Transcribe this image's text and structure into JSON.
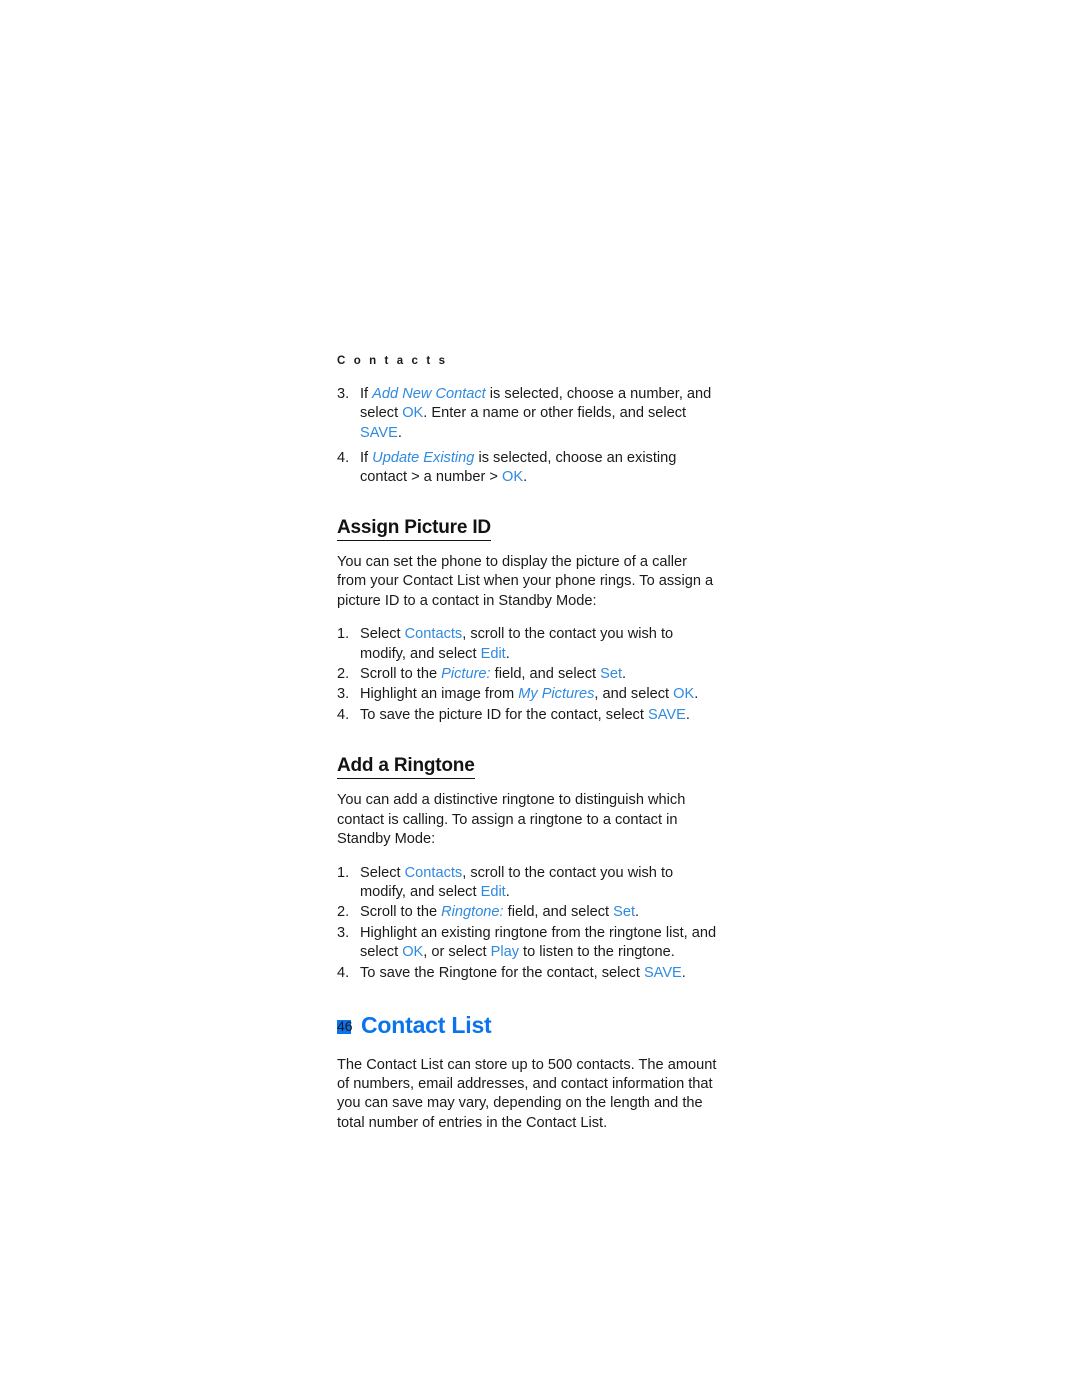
{
  "document": {
    "running_header": "C o n t a c t s",
    "page_number": "46",
    "accent_color": "#2f8ae0",
    "section_heading_color": "#0a74ec",
    "text_color": "#1a1a1a",
    "background_color": "#ffffff"
  },
  "top_steps": {
    "items": [
      {
        "num": "3.",
        "parts": [
          {
            "t": "If ",
            "style": "plain"
          },
          {
            "t": "Add New Contact",
            "style": "ui-italic"
          },
          {
            "t": " is selected, choose a number, and select ",
            "style": "plain"
          },
          {
            "t": "OK",
            "style": "ui"
          },
          {
            "t": ". Enter a name or other fields, and select ",
            "style": "plain"
          },
          {
            "t": "SAVE",
            "style": "ui"
          },
          {
            "t": ".",
            "style": "plain"
          }
        ]
      },
      {
        "num": "4.",
        "parts": [
          {
            "t": "If ",
            "style": "plain"
          },
          {
            "t": "Update Existing",
            "style": "ui-italic"
          },
          {
            "t": " is selected, choose an existing contact > a number > ",
            "style": "plain"
          },
          {
            "t": "OK",
            "style": "ui"
          },
          {
            "t": ".",
            "style": "plain"
          }
        ]
      }
    ]
  },
  "assign_picture_id": {
    "heading": "Assign Picture ID",
    "intro": "You can set the phone to display the picture of a caller from your Contact List when your phone rings. To assign a picture ID to a contact in Standby Mode:",
    "steps": [
      {
        "num": "1.",
        "parts": [
          {
            "t": "Select ",
            "style": "plain"
          },
          {
            "t": "Contacts",
            "style": "ui"
          },
          {
            "t": ", scroll to the contact you wish to modify, and select ",
            "style": "plain"
          },
          {
            "t": "Edit",
            "style": "ui"
          },
          {
            "t": ".",
            "style": "plain"
          }
        ]
      },
      {
        "num": "2.",
        "parts": [
          {
            "t": "Scroll to the ",
            "style": "plain"
          },
          {
            "t": "Picture:",
            "style": "ui-italic"
          },
          {
            "t": " field, and select ",
            "style": "plain"
          },
          {
            "t": "Set",
            "style": "ui"
          },
          {
            "t": ".",
            "style": "plain"
          }
        ]
      },
      {
        "num": "3.",
        "parts": [
          {
            "t": "Highlight an image from ",
            "style": "plain"
          },
          {
            "t": "My Pictures",
            "style": "ui-italic"
          },
          {
            "t": ", and select ",
            "style": "plain"
          },
          {
            "t": "OK",
            "style": "ui"
          },
          {
            "t": ".",
            "style": "plain"
          }
        ]
      },
      {
        "num": "4.",
        "parts": [
          {
            "t": "To save the picture ID for the contact, select ",
            "style": "plain"
          },
          {
            "t": "SAVE",
            "style": "ui"
          },
          {
            "t": ".",
            "style": "plain"
          }
        ]
      }
    ]
  },
  "add_a_ringtone": {
    "heading": "Add a Ringtone",
    "intro": "You can add a distinctive ringtone to distinguish which contact is calling. To assign a ringtone to a contact in Standby Mode:",
    "steps": [
      {
        "num": "1.",
        "parts": [
          {
            "t": "Select ",
            "style": "plain"
          },
          {
            "t": "Contacts",
            "style": "ui"
          },
          {
            "t": ", scroll to the contact you wish to modify, and select ",
            "style": "plain"
          },
          {
            "t": "Edit",
            "style": "ui"
          },
          {
            "t": ".",
            "style": "plain"
          }
        ]
      },
      {
        "num": "2.",
        "parts": [
          {
            "t": "Scroll to the ",
            "style": "plain"
          },
          {
            "t": "Ringtone:",
            "style": "ui-italic"
          },
          {
            "t": " field, and select ",
            "style": "plain"
          },
          {
            "t": "Set",
            "style": "ui"
          },
          {
            "t": ".",
            "style": "plain"
          }
        ]
      },
      {
        "num": "3.",
        "parts": [
          {
            "t": "Highlight an existing ringtone from the ringtone list, and select ",
            "style": "plain"
          },
          {
            "t": "OK",
            "style": "ui"
          },
          {
            "t": ", or select ",
            "style": "plain"
          },
          {
            "t": "Play",
            "style": "ui"
          },
          {
            "t": " to listen to the ringtone.",
            "style": "plain"
          }
        ]
      },
      {
        "num": "4.",
        "parts": [
          {
            "t": "To save the Ringtone for the contact, select ",
            "style": "plain"
          },
          {
            "t": "SAVE",
            "style": "ui"
          },
          {
            "t": ".",
            "style": "plain"
          }
        ]
      }
    ]
  },
  "contact_list": {
    "heading": "Contact List",
    "bullet_icon": "square-bullet-icon",
    "body": "The Contact List can store up to 500 contacts. The amount of numbers, email addresses, and contact information that you can save may vary, depending on the length and the total number of entries in the Contact List."
  }
}
